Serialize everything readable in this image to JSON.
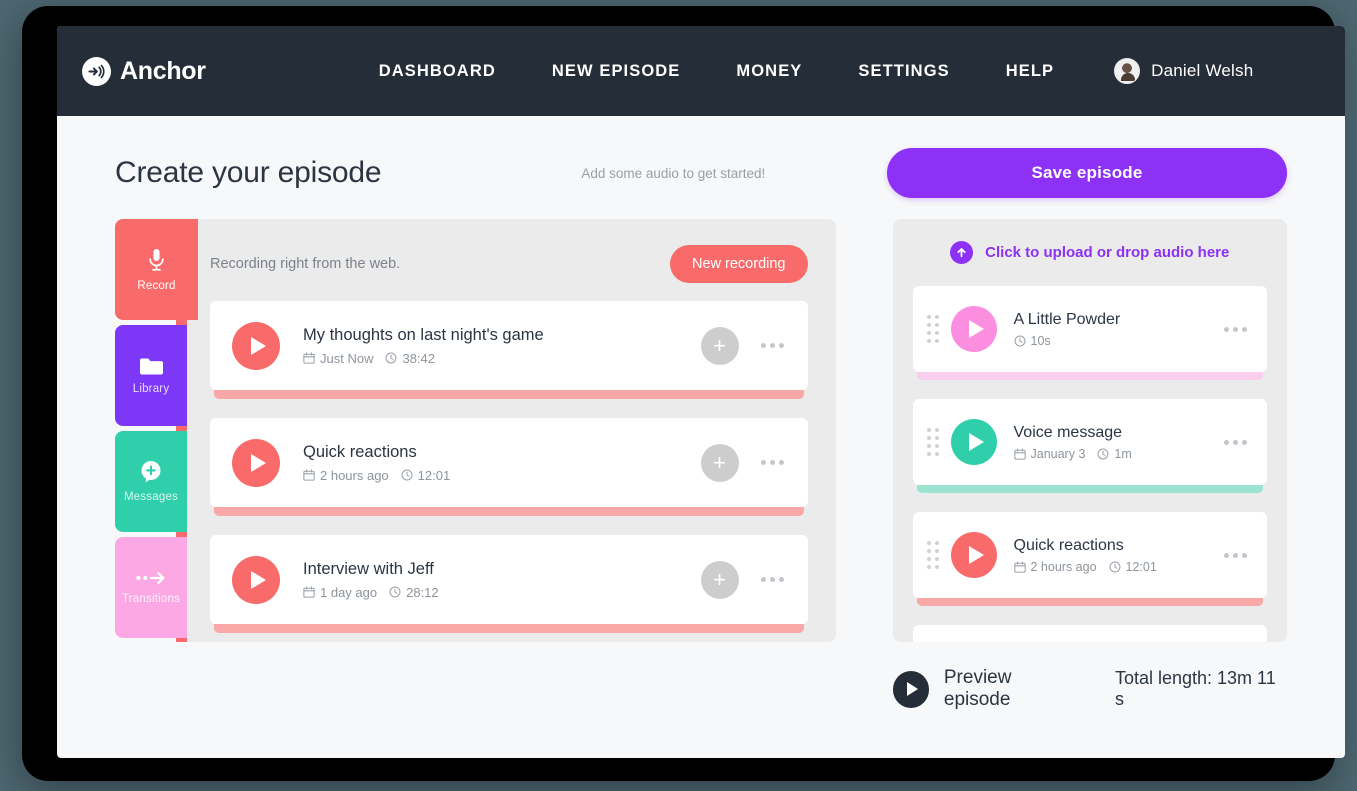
{
  "nav": {
    "brand": "Anchor",
    "brand_icon": "anchor-logo-icon",
    "links": [
      "DASHBOARD",
      "NEW EPISODE",
      "MONEY",
      "SETTINGS",
      "HELP"
    ],
    "user_name": "Daniel Welsh",
    "avatar_icon": "user-avatar"
  },
  "page": {
    "title": "Create your episode",
    "hint": "Add some audio to get started!",
    "save_label": "Save episode",
    "save_color": "#8c31f5"
  },
  "tabs": [
    {
      "label": "Record",
      "icon": "microphone-icon",
      "color": "#f96a6a",
      "active": true
    },
    {
      "label": "Library",
      "icon": "folder-icon",
      "color": "#7d37f7",
      "active": false
    },
    {
      "label": "Messages",
      "icon": "message-plus-icon",
      "color": "#2fcfab",
      "active": false
    },
    {
      "label": "Transitions",
      "icon": "arrow-right-icon",
      "color": "#fba8e4",
      "active": false
    }
  ],
  "recordings_panel": {
    "heading": "Recording right from the web.",
    "new_recording_label": "New recording",
    "accent_color": "#f96a6a",
    "items": [
      {
        "title": "My thoughts on last night's game",
        "date": "Just Now",
        "duration": "38:42",
        "color": "#f96a6a",
        "bar": "#f9a8a8",
        "add_label": "+"
      },
      {
        "title": "Quick reactions",
        "date": "2 hours ago",
        "duration": "12:01",
        "color": "#f96a6a",
        "bar": "#f9a8a8",
        "add_label": "+"
      },
      {
        "title": "Interview with Jeff",
        "date": "1 day ago",
        "duration": "28:12",
        "color": "#f96a6a",
        "bar": "#f9a8a8",
        "add_label": "+"
      }
    ]
  },
  "episode_panel": {
    "upload_label": "Click to upload or drop audio here",
    "upload_icon": "upload-arrow-icon",
    "upload_color": "#8c31f5",
    "items": [
      {
        "title": "A Little Powder",
        "date": "",
        "duration": "10s",
        "color": "#fb8ede",
        "bar": "#fbcdee"
      },
      {
        "title": "Voice message",
        "date": "January 3",
        "duration": "1m",
        "color": "#2fcfab",
        "bar": "#9ce3d2"
      },
      {
        "title": "Quick reactions",
        "date": "2 hours ago",
        "duration": "12:01",
        "color": "#f96a6a",
        "bar": "#f9a8a8"
      }
    ]
  },
  "footer": {
    "preview_label": "Preview episode",
    "preview_icon": "play-icon",
    "total_length": "Total length: 13m 11 s"
  }
}
